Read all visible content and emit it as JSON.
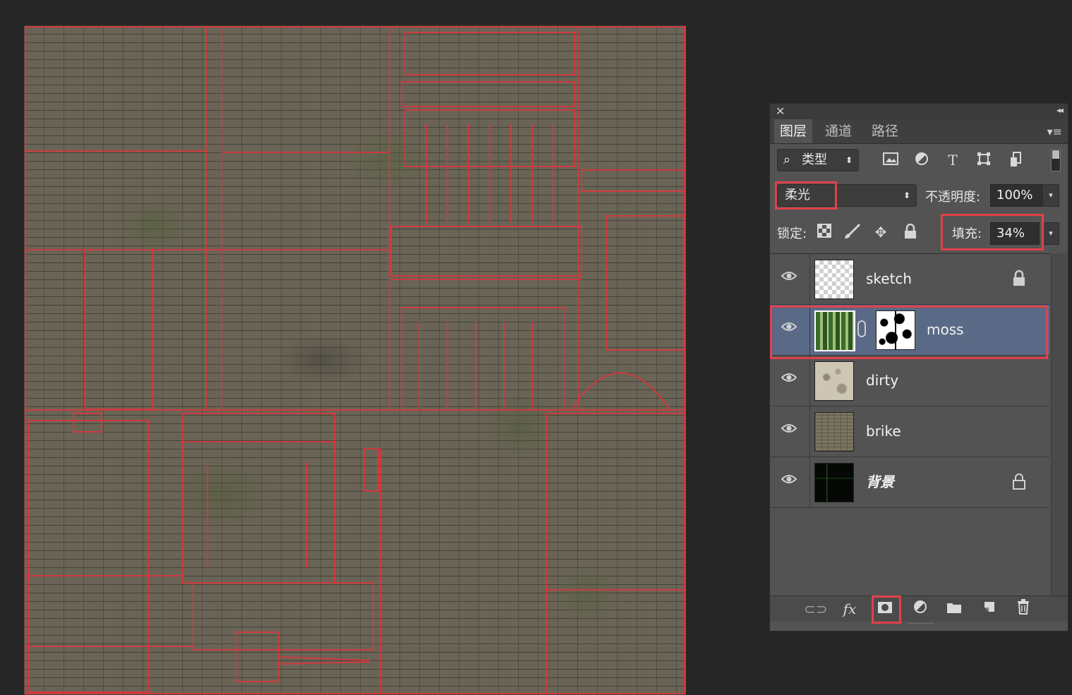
{
  "canvas": {
    "description_colors": {
      "guides": "#e0343c",
      "wall": "#6a6456",
      "moss": "#55603c"
    }
  },
  "panel": {
    "close_icon": "close-icon",
    "collapse_icon": "collapse-icon",
    "tabs": [
      {
        "label": "图层",
        "active": true
      },
      {
        "label": "通道",
        "active": false
      },
      {
        "label": "路径",
        "active": false
      }
    ],
    "menu_icon": "panel-menu-icon",
    "filter": {
      "kind_label": "类型",
      "icons": [
        "image-filter-icon",
        "adjustment-filter-icon",
        "type-filter-icon",
        "shape-filter-icon",
        "smart-object-filter-icon"
      ]
    },
    "blend": {
      "mode": "柔光",
      "opacity_label": "不透明度:",
      "opacity_value": "100%"
    },
    "lock": {
      "label": "锁定:",
      "icons": [
        "lock-transparent-icon",
        "lock-paint-icon",
        "lock-position-icon",
        "lock-all-icon"
      ],
      "fill_label": "填充:",
      "fill_value": "34%"
    },
    "layers": [
      {
        "name": "sketch",
        "visible": true,
        "locked": true,
        "selected": false,
        "thumb": "checker"
      },
      {
        "name": "moss",
        "visible": true,
        "locked": false,
        "selected": true,
        "thumb": "mossimg",
        "mask": true
      },
      {
        "name": "dirty",
        "visible": true,
        "locked": false,
        "selected": false,
        "thumb": "dirtyimg"
      },
      {
        "name": "brike",
        "visible": true,
        "locked": false,
        "selected": false,
        "thumb": "brickimg"
      },
      {
        "name": "背景",
        "visible": true,
        "locked": true,
        "selected": false,
        "thumb": "bgimg"
      }
    ],
    "bottom_icons": [
      "link-layers-icon",
      "fx-icon",
      "add-mask-icon",
      "adjustment-layer-icon",
      "new-group-icon",
      "new-layer-icon",
      "trash-icon"
    ],
    "fx_label": "fx",
    "highlight_color": "#e2414a",
    "selected_color": "#5a6a86"
  }
}
